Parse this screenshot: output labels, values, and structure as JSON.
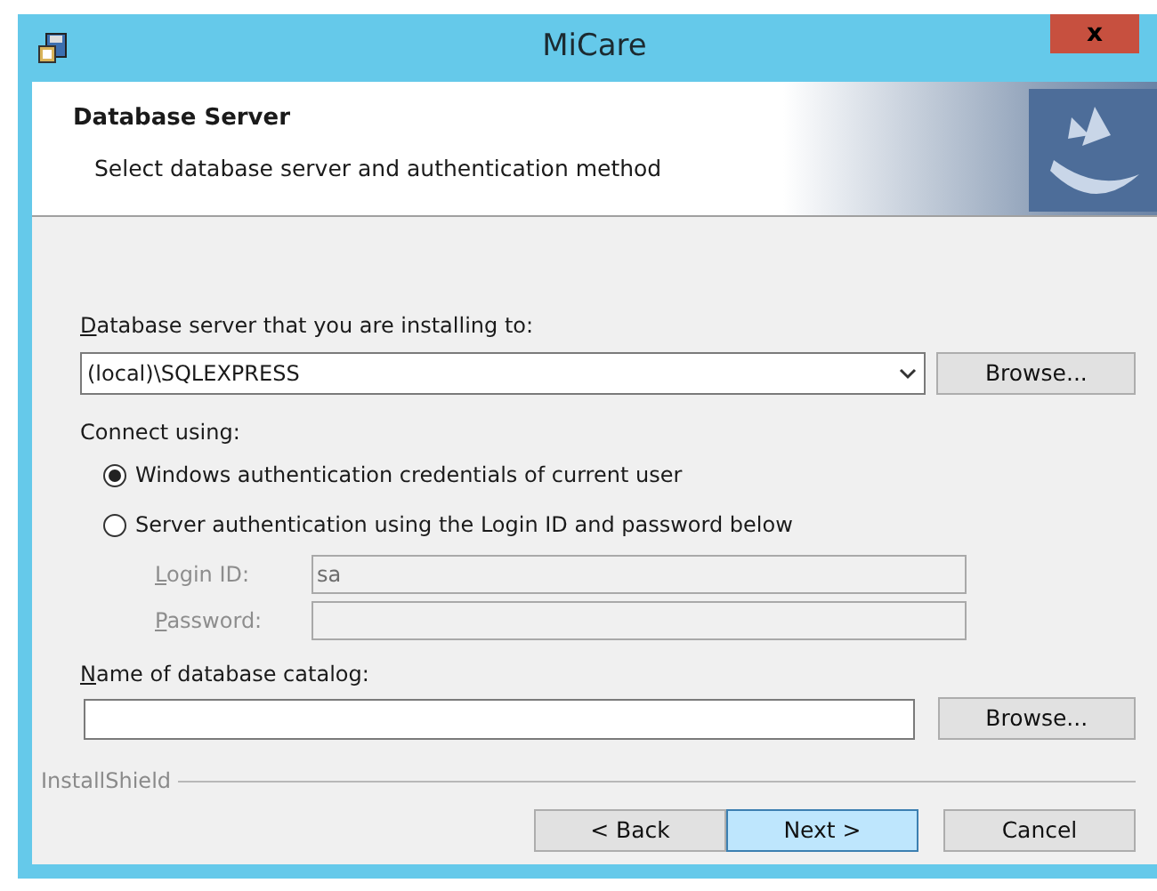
{
  "window": {
    "title": "MiCare",
    "close": "x"
  },
  "header": {
    "title": "Database Server",
    "subtitle": "Select database server and authentication method"
  },
  "server": {
    "label": "Database server that you are installing to:",
    "value": "(local)\\SQLEXPRESS",
    "browse": "Browse..."
  },
  "connect": {
    "label": "Connect using:",
    "options": [
      {
        "label": "Windows authentication credentials of current user",
        "selected": true
      },
      {
        "label": "Server authentication using the Login ID and password below",
        "selected": false
      }
    ],
    "fields": [
      {
        "label": "Login ID:",
        "value": "sa",
        "disabled": true
      },
      {
        "label": "Password:",
        "disabled": true
      }
    ]
  },
  "catalog": {
    "label": "Name of database catalog:",
    "browse": "Browse..."
  },
  "brand": "InstallShield",
  "buttons": [
    {
      "label": "< Back",
      "default": false
    },
    {
      "label": "Next >",
      "default": true
    },
    {
      "label": "Cancel",
      "default": false
    }
  ]
}
